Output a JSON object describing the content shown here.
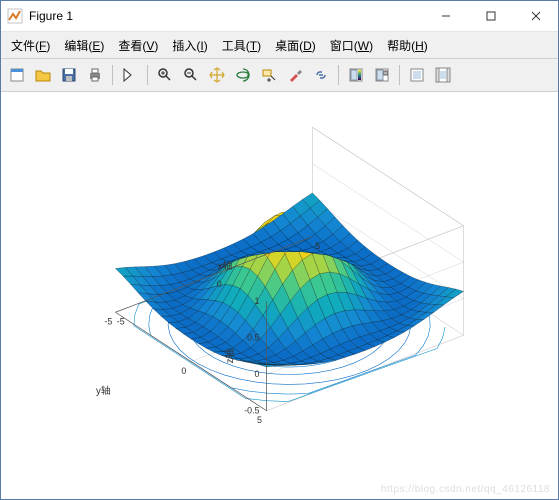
{
  "window": {
    "title": "Figure 1",
    "min_tooltip": "Minimize",
    "max_tooltip": "Maximize",
    "close_tooltip": "Close"
  },
  "menubar": {
    "items": [
      {
        "label": "文件",
        "accel": "F"
      },
      {
        "label": "编辑",
        "accel": "E"
      },
      {
        "label": "查看",
        "accel": "V"
      },
      {
        "label": "插入",
        "accel": "I"
      },
      {
        "label": "工具",
        "accel": "T"
      },
      {
        "label": "桌面",
        "accel": "D"
      },
      {
        "label": "窗口",
        "accel": "W"
      },
      {
        "label": "帮助",
        "accel": "H"
      }
    ]
  },
  "toolbar": {
    "groups": [
      [
        "new-figure",
        "open-file",
        "save",
        "print"
      ],
      [
        "edit-plot"
      ],
      [
        "zoom-in",
        "zoom-out",
        "pan",
        "rotate-3d",
        "data-cursor",
        "brush",
        "link"
      ],
      [
        "insert-colorbar",
        "insert-legend"
      ],
      [
        "hide-plot-tools",
        "show-plot-tools"
      ]
    ]
  },
  "watermark": "https://blog.csdn.net/qq_46126118",
  "chart_data": {
    "type": "surface3d_with_contours",
    "title": "",
    "xlabel": "x轴",
    "ylabel": "y轴",
    "zlabel": "z轴",
    "xlim": [
      -5,
      5
    ],
    "ylim": [
      -5,
      5
    ],
    "zlim": [
      -0.5,
      1
    ],
    "xticks": [
      -5,
      0,
      5
    ],
    "yticks": [
      -5,
      0,
      5
    ],
    "zticks": [
      -0.5,
      0,
      0.5,
      1
    ],
    "colormap": "parula",
    "function": "z = sin(sqrt(x^2+y^2)) / sqrt(x^2+y^2)  (sinc radial)",
    "grid_step": 0.5,
    "x": [
      -5,
      -4.5,
      -4,
      -3.5,
      -3,
      -2.5,
      -2,
      -1.5,
      -1,
      -0.5,
      0,
      0.5,
      1,
      1.5,
      2,
      2.5,
      3,
      3.5,
      4,
      4.5,
      5
    ],
    "y": [
      -5,
      -4.5,
      -4,
      -3.5,
      -3,
      -2.5,
      -2,
      -1.5,
      -1,
      -0.5,
      0,
      0.5,
      1,
      1.5,
      2,
      2.5,
      3,
      3.5,
      4,
      4.5,
      5
    ],
    "z_along_x_axis_y0": [
      -0.192,
      -0.218,
      -0.189,
      -0.1,
      0.047,
      0.239,
      0.455,
      0.665,
      0.841,
      0.959,
      1.0,
      0.959,
      0.841,
      0.665,
      0.455,
      0.239,
      0.047,
      -0.1,
      -0.189,
      -0.218,
      -0.192
    ],
    "contour_levels": [
      -0.2,
      -0.1,
      0,
      0.1,
      0.2,
      0.3,
      0.4,
      0.5,
      0.6,
      0.7,
      0.8,
      0.9
    ],
    "view_azimuth": -37.5,
    "view_elevation": 30
  }
}
